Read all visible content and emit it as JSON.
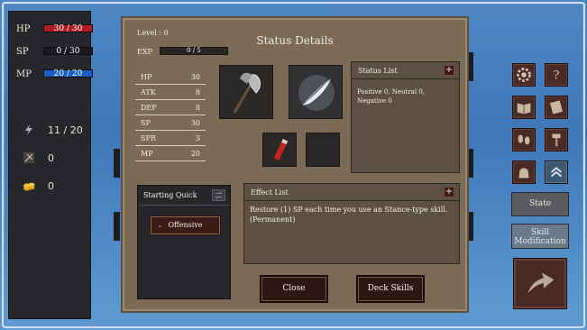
{
  "left_panel": {
    "hp": {
      "label": "HP",
      "value": "30 / 30",
      "fraction": 1.0,
      "color": "#c81e24"
    },
    "sp": {
      "label": "SP",
      "value": "0 / 30",
      "fraction": 0.0,
      "color": "#888888"
    },
    "mp": {
      "label": "MP",
      "value": "20 / 20",
      "fraction": 1.0,
      "color": "#1e6ad0"
    },
    "energy": {
      "icon": "lightning-icon",
      "value": "11 / 20"
    },
    "tokens": {
      "icon": "rune-icon",
      "value": "0"
    },
    "gold": {
      "icon": "gold-coins-icon",
      "value": "0"
    }
  },
  "status": {
    "title": "Status Details",
    "level": "Level : 0",
    "exp_label": "EXP",
    "exp_value": "0 / 5",
    "stats": [
      {
        "name": "HP",
        "value": "30"
      },
      {
        "name": "ATK",
        "value": "8"
      },
      {
        "name": "DEF",
        "value": "8"
      },
      {
        "name": "SP",
        "value": "30"
      },
      {
        "name": "SPR",
        "value": "3"
      },
      {
        "name": "MP",
        "value": "20"
      }
    ],
    "status_list": {
      "title": "Status List",
      "plus": "+",
      "text": "Positive 0, Neutral 0, Negative 0"
    },
    "starting_quick": {
      "title": "Starting Quick",
      "button": "Offensive"
    },
    "effect_list": {
      "title": "Effect List",
      "plus": "+",
      "text": "Restore (1) SP each time you use an Stance-type skill. (Permanent)"
    },
    "close_label": "Close",
    "deck_label": "Deck Skills"
  },
  "right_panel": {
    "icons": [
      "gear-icon",
      "help-icon",
      "book-icon",
      "scroll-icon",
      "footprints-icon",
      "hammer-icon",
      "bag-icon",
      "chevrons-up-icon"
    ],
    "help_glyph": "?",
    "state_label": "State",
    "skill_mod_label_1": "Skill",
    "skill_mod_label_2": "Modification"
  }
}
